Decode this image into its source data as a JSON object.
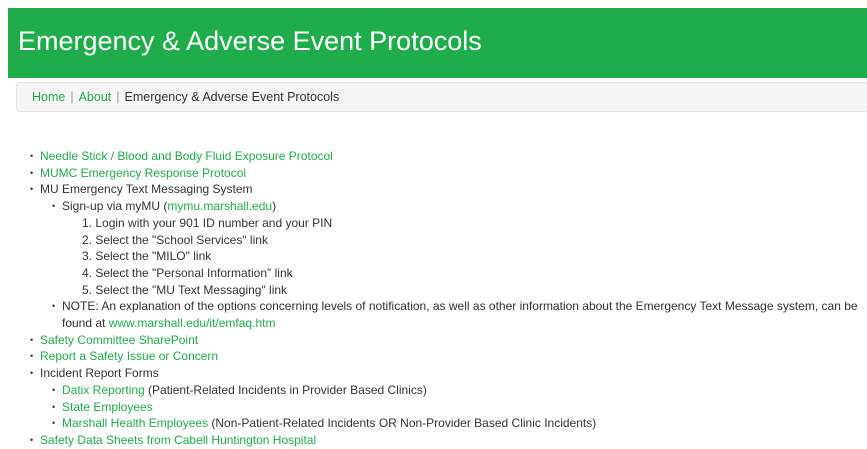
{
  "header": {
    "title": "Emergency & Adverse Event Protocols",
    "color": "#1fad4b"
  },
  "breadcrumb": {
    "home": "Home",
    "about": "About",
    "current": "Emergency & Adverse Event Protocols",
    "sep": "|"
  },
  "items": {
    "needle_stick": "Needle Stick / Blood and Body Fluid Exposure Protocol",
    "mumc_emergency": "MUMC Emergency Response Protocol",
    "text_messaging": {
      "label": "MU Emergency Text Messaging System",
      "signup_prefix": "Sign-up via myMU (",
      "signup_link": "mymu.marshall.edu",
      "signup_suffix": ")",
      "steps": [
        "1. Login with your 901 ID number and your PIN",
        "2. Select the \"School Services\" link",
        "3. Select the \"MILO\" link",
        "4. Select the \"Personal Information\" link",
        "5. Select the \"MU Text Messaging\" link"
      ],
      "note_text": "NOTE: An explanation of the options concerning levels of notification, as well as other information about the Emergency Text Message system, can be found at ",
      "note_link": "www.marshall.edu/it/emfaq.htm"
    },
    "safety_committee": "Safety Committee SharePoint",
    "report_safety": "Report a Safety Issue or Concern",
    "incident_forms": {
      "label": "Incident Report Forms",
      "datix_link": "Datix Reporting",
      "datix_note": " (Patient-Related Incidents in Provider Based Clinics)",
      "state_employees": "State Employees",
      "mhe_link": "Marshall Health Employees",
      "mhe_note": " (Non-Patient-Related Incidents OR Non-Provider Based Clinic Incidents)"
    },
    "safety_data_sheets": "Safety Data Sheets from Cabell Huntington Hospital"
  }
}
